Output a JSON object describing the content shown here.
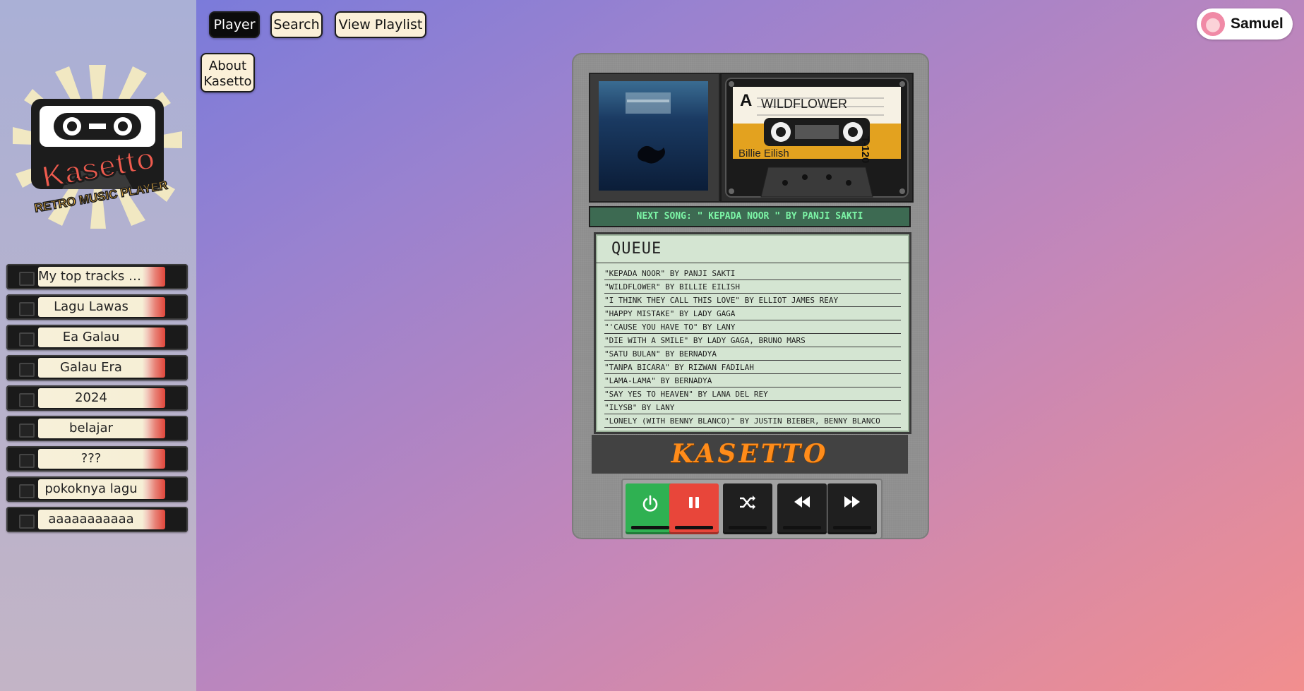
{
  "app": {
    "name": "Kasetto",
    "tagline": "RETRO MUSIC PLAYER"
  },
  "nav": {
    "player": "Player",
    "search": "Search",
    "view_playlist": "View Playlist",
    "about_line1": "About",
    "about_line2": "Kasetto"
  },
  "user": {
    "name": "Samuel"
  },
  "playlists": [
    {
      "label": "My top tracks p..."
    },
    {
      "label": "Lagu Lawas"
    },
    {
      "label": "Ea Galau"
    },
    {
      "label": "Galau Era"
    },
    {
      "label": "2024"
    },
    {
      "label": "belajar"
    },
    {
      "label": "???"
    },
    {
      "label": "pokoknya lagu"
    },
    {
      "label": "aaaaaaaaaaa"
    }
  ],
  "now_playing": {
    "side": "A",
    "title": "WILDFLOWER",
    "artist": "Billie Eilish",
    "tape_type": "T-120"
  },
  "next_song": "NEXT SONG: \" KEPADA NOOR \" BY PANJI SAKTI",
  "queue": {
    "title": "QUEUE",
    "items": [
      "\"KEPADA NOOR\" BY PANJI SAKTI",
      "\"WILDFLOWER\" BY BILLIE EILISH",
      "\"I THINK THEY CALL THIS LOVE\" BY ELLIOT JAMES REAY",
      "\"HAPPY MISTAKE\" BY LADY GAGA",
      "\"'CAUSE YOU HAVE TO\" BY LANY",
      "\"DIE WITH A SMILE\" BY LADY GAGA, BRUNO MARS",
      "\"SATU BULAN\" BY BERNADYA",
      "\"TANPA BICARA\" BY RIZWAN FADILAH",
      "\"LAMA-LAMA\" BY BERNADYA",
      "\"SAY YES TO HEAVEN\" BY LANA DEL REY",
      "\"ILYSB\" BY LANY",
      "\"LONELY (WITH BENNY BLANCO)\" BY JUSTIN BIEBER, BENNY BLANCO"
    ]
  },
  "brand_plate": "KASETTO",
  "controls": [
    {
      "name": "power",
      "icon": "power-icon",
      "color": "#2fb152"
    },
    {
      "name": "pause",
      "icon": "pause-icon",
      "color": "#e8463a"
    },
    {
      "name": "shuffle",
      "icon": "shuffle-icon",
      "color": "#1f1f1f"
    },
    {
      "name": "rewind",
      "icon": "rewind-icon",
      "color": "#1f1f1f"
    },
    {
      "name": "fast-forward",
      "icon": "fast-forward-icon",
      "color": "#1f1f1f"
    }
  ],
  "colors": {
    "accent_orange": "#ff8c1a",
    "lcd_green": "#7cf5a6",
    "tape_label_orange": "#e5a21f"
  }
}
